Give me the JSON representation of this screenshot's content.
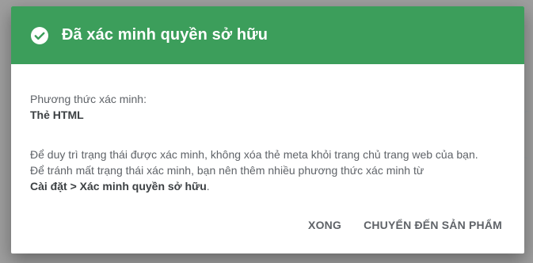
{
  "dialog": {
    "title": "Đã xác minh quyền sở hữu",
    "header_color": "#3c9e5b",
    "icon": "check-circle-icon",
    "method_label": "Phương thức xác minh:",
    "method_value": "Thẻ HTML",
    "info_line1": "Để duy trì trạng thái được xác minh, không xóa thẻ meta khỏi trang chủ trang web của bạn.",
    "info_line2": "Để tránh mất trạng thái xác minh, bạn nên thêm nhiều phương thức xác minh từ",
    "info_path": "Cài đặt > Xác minh quyền sở hữu",
    "info_period": ".",
    "done_button": "XONG",
    "goto_button": "CHUYỂN ĐẾN SẢN PHẨM"
  }
}
